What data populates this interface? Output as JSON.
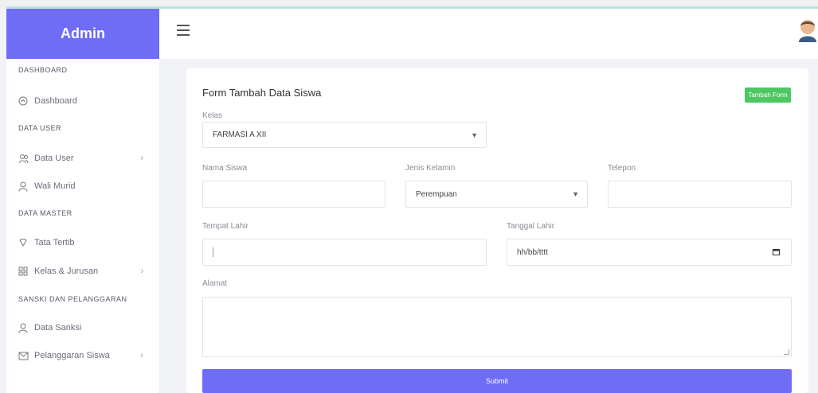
{
  "sidebar": {
    "brand": "Admin",
    "headings": [
      "DASHBOARD",
      "DATA USER",
      "DATA MASTER",
      "SANSKI DAN PELANGGARAN"
    ],
    "items": [
      {
        "label": "Dashboard",
        "icon": "dashboard-icon"
      },
      {
        "label": "Data User",
        "icon": "users-icon",
        "has_submenu": true
      },
      {
        "label": "Wali Murid",
        "icon": "user-icon"
      },
      {
        "label": "Tata Tertib",
        "icon": "rules-icon"
      },
      {
        "label": "Kelas & Jurusan",
        "icon": "grid-icon",
        "has_submenu": true
      },
      {
        "label": "Data Sanksi",
        "icon": "sanction-icon"
      },
      {
        "label": "Pelanggaran Siswa",
        "icon": "mail-icon",
        "has_submenu": true
      }
    ]
  },
  "navbar": {
    "menu_icon": "hamburger-icon",
    "avatar_icon": "avatar-icon"
  },
  "form": {
    "title": "Form Tambah Data Siswa",
    "add_button": "Tambah Form",
    "kelas": {
      "label": "Kelas",
      "value": "FARMASI A XII"
    },
    "nama": {
      "label": "Nama Siswa",
      "value": ""
    },
    "jenis_kelamin": {
      "label": "Jenis Kelamin",
      "value": "Perempuan"
    },
    "telepon": {
      "label": "Telepon",
      "value": ""
    },
    "tempat_lahir": {
      "label": "Tempat Lahir",
      "value": ""
    },
    "tanggal_lahir": {
      "label": "Tanggal Lahir",
      "placeholder": "hh/bb/tttt"
    },
    "alamat": {
      "label": "Alamat",
      "value": ""
    },
    "submit": "Submit"
  },
  "colors": {
    "brand": "#6f6cf6",
    "success": "#4dc762",
    "background": "#f2f3f7"
  }
}
